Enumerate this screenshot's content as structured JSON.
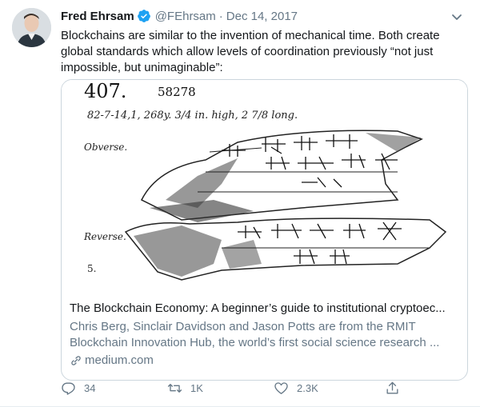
{
  "tweet": {
    "author_name": "Fred Ehrsam",
    "handle": "@FEhrsam",
    "separator": "·",
    "date": "Dec 14, 2017",
    "text": "Blockchains are similar to the invention of mechanical time. Both create global standards which allow levels of coordination previously “not just impossible, but unimaginable”:"
  },
  "card": {
    "image_text": {
      "number": "407.",
      "catalog": "58278",
      "measure": "82-7-14,1, 268y.  3/4 in. high, 2 7/8 long.",
      "obverse": "Obverse.",
      "reverse": "Reverse.",
      "five": "5."
    },
    "title": "The Blockchain Economy: A beginner’s guide to institutional cryptoec...",
    "description": "Chris Berg, Sinclair Davidson and Jason Potts are from the RMIT Blockchain Innovation Hub, the world’s first social science research ...",
    "domain": "medium.com"
  },
  "actions": {
    "replies": "34",
    "retweets": "1K",
    "likes": "2.3K"
  },
  "colors": {
    "accent": "#1da1f2",
    "muted": "#657786",
    "border": "#ccd6dd"
  },
  "icons": [
    "verified-badge-icon",
    "chevron-down-icon",
    "link-icon",
    "reply-icon",
    "retweet-icon",
    "like-icon",
    "share-icon"
  ]
}
